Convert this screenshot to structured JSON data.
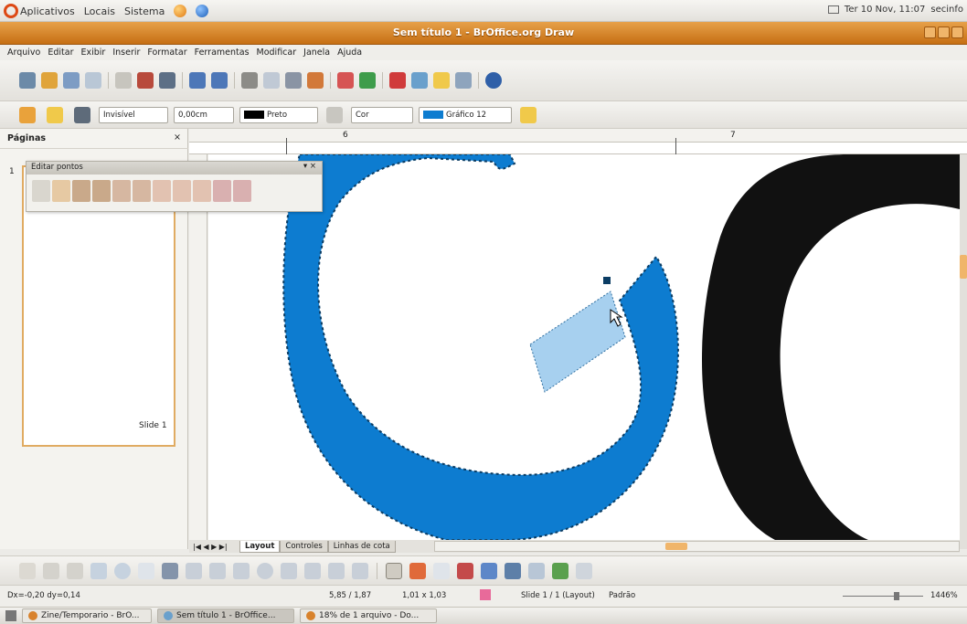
{
  "gnome": {
    "menus": [
      "Aplicativos",
      "Locais",
      "Sistema"
    ],
    "clock": "Ter 10 Nov, 11:07",
    "user": "secinfo"
  },
  "window": {
    "title": "Sem título 1 - BrOffice.org Draw"
  },
  "menubar": [
    "Arquivo",
    "Editar",
    "Exibir",
    "Inserir",
    "Formatar",
    "Ferramentas",
    "Modificar",
    "Janela",
    "Ajuda"
  ],
  "line_toolbar": {
    "line_style": "Invisível",
    "line_width": "0,00cm",
    "line_color": "Preto",
    "area_style": "Cor",
    "area_color": "Gráfico 12"
  },
  "pages_pane": {
    "title": "Páginas",
    "page_number": "1",
    "slide_label": "Slide 1"
  },
  "edit_points": {
    "title": "Editar pontos"
  },
  "ruler": {
    "labels": [
      "6",
      "7"
    ]
  },
  "tabs": [
    "Layout",
    "Controles",
    "Linhas de cota"
  ],
  "status": {
    "delta": "Dx=-0,20 dy=0,14",
    "position": "5,85 / 1,87",
    "size": "1,01 x 1,03",
    "slide": "Slide 1 / 1 (Layout)",
    "layout": "Padrão",
    "zoom": "1446%"
  },
  "taskbar": [
    "Zine/Temporario - BrO...",
    "Sem título 1 - BrOffice...",
    "18% de 1 arquivo - Do..."
  ],
  "colors": {
    "shape_blue": "#0d7cd0",
    "selected_segment": "#a7d0ef",
    "title_orange": "#d8822c"
  }
}
